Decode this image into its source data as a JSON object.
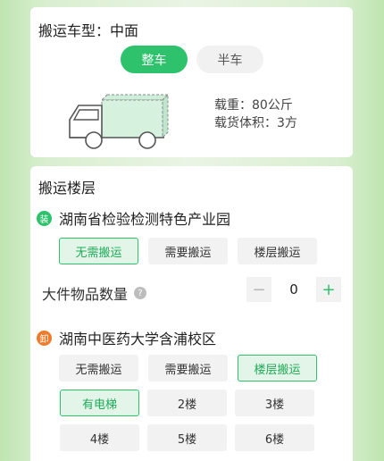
{
  "vehicle": {
    "title_label": "搬运车型：",
    "title_value": "中面",
    "tabs": [
      "整车",
      "半车"
    ],
    "load_weight": "载重：80公斤",
    "cargo_volume": "载货体积：3方"
  },
  "floors": {
    "title": "搬运楼层",
    "origin": {
      "badge": "装",
      "name": "湖南省检验检测特色产业园",
      "options": [
        "无需搬运",
        "需要搬运",
        "楼层搬运"
      ],
      "selected": "无需搬运"
    },
    "bulky": {
      "label": "大件物品数量",
      "help_glyph": "?",
      "minus": "−",
      "value": "0",
      "plus": "+"
    },
    "destination": {
      "badge": "卸",
      "name": "湖南中医药大学含浦校区",
      "options": [
        "无需搬运",
        "需要搬运",
        "楼层搬运"
      ],
      "selected": "楼层搬运",
      "floor_options": [
        "有电梯",
        "2楼",
        "3楼",
        "4楼",
        "5楼",
        "6楼"
      ],
      "floor_selected": "有电梯"
    }
  },
  "colors": {
    "accent": "#2dc26b",
    "load_badge": "#2dc26b",
    "unload_badge": "#f07b2c"
  }
}
